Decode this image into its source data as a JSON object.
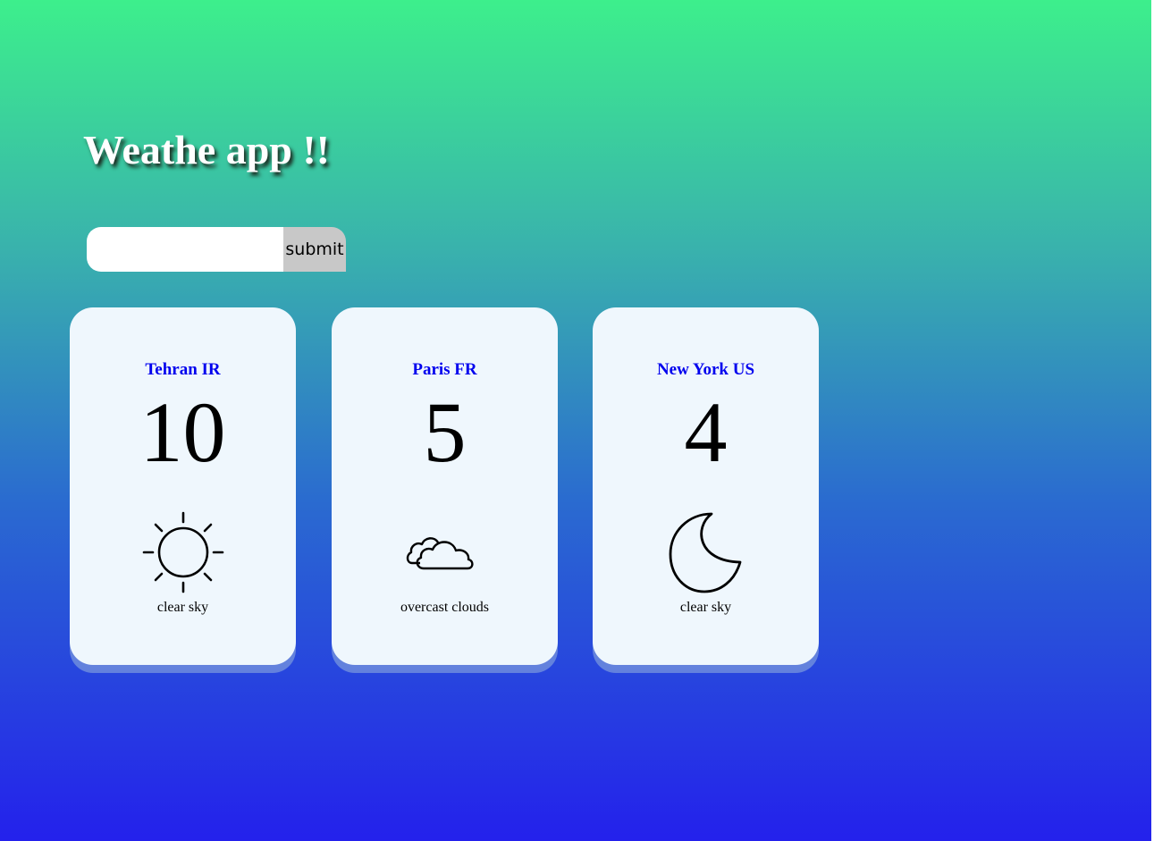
{
  "app": {
    "title": "Weathe app !!"
  },
  "search": {
    "value": "",
    "placeholder": "",
    "submit_label": "submit"
  },
  "cards": [
    {
      "city": "Tehran IR",
      "temp": "10",
      "icon": "sun-icon",
      "description": "clear sky"
    },
    {
      "city": "Paris FR",
      "temp": "5",
      "icon": "clouds-icon",
      "description": "overcast clouds"
    },
    {
      "city": "New York US",
      "temp": "4",
      "icon": "moon-icon",
      "description": "clear sky"
    }
  ],
  "colors": {
    "gradient_top": "#3def8c",
    "gradient_bottom": "#2421ec",
    "card_bg": "#eff7fd",
    "city_link": "#0000ee",
    "submit_bg": "#c8c8c8"
  }
}
